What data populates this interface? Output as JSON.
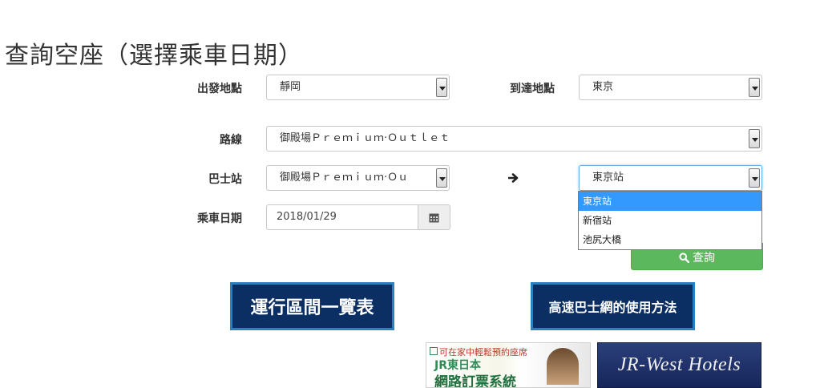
{
  "page": {
    "title": "查詢空座（選擇乘車日期）"
  },
  "form": {
    "departure": {
      "label": "出發地點",
      "value": "靜岡"
    },
    "arrival": {
      "label": "到達地點",
      "value": "東京"
    },
    "route": {
      "label": "路線",
      "value": "御殿場Ｐｒｅｍｉｕｍ·Ｏｕｔｌｅｔ"
    },
    "bus_stop": {
      "label": "巴士站",
      "from_value": "御殿場Ｐｒｅｍｉｕｍ·Ｏｕ",
      "to_value": "東京站",
      "arrow_icon": "arrow-right-icon"
    },
    "date": {
      "label": "乘車日期",
      "value": "2018/01/29",
      "icon": "calendar-icon"
    },
    "search_button": {
      "label": "查詢",
      "icon": "search-icon",
      "color": "#5cb85c"
    }
  },
  "dropdown": {
    "options": [
      "東京站",
      "新宿站",
      "池尻大橋"
    ],
    "selected_index": 0,
    "highlight_color": "#3399ff"
  },
  "links": {
    "route_list": {
      "label": "運行區間一覽表"
    },
    "howto": {
      "label": "高速巴士網的使用方法"
    }
  },
  "banners": {
    "jr_east": {
      "line1": "可在家中輕鬆預約座席",
      "line2": "JR東日本",
      "line3": "網路訂票系統"
    },
    "jr_west": {
      "label": "JR-West Hotels"
    }
  },
  "colors": {
    "nav_button_bg": "#0b2e63",
    "nav_button_border": "#2a7fbf"
  }
}
